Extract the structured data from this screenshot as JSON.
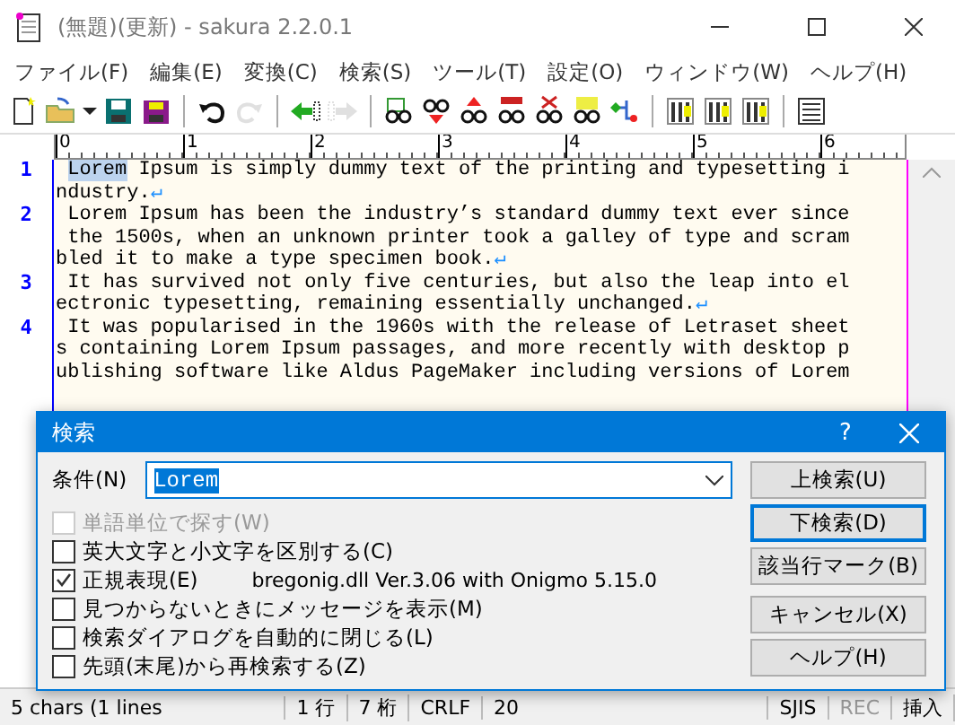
{
  "window": {
    "title": "(無題)(更新) - sakura 2.2.0.1"
  },
  "menu": [
    "ファイル(F)",
    "編集(E)",
    "変換(C)",
    "検索(S)",
    "ツール(T)",
    "設定(O)",
    "ウィンドウ(W)",
    "ヘルプ(H)"
  ],
  "toolbar": [
    {
      "kind": "new",
      "disabled": false
    },
    {
      "kind": "open",
      "disabled": false
    },
    {
      "kind": "caret",
      "disabled": false
    },
    {
      "kind": "save",
      "disabled": false
    },
    {
      "kind": "saveas",
      "disabled": false
    },
    {
      "kind": "separator"
    },
    {
      "kind": "undo",
      "disabled": false
    },
    {
      "kind": "redo",
      "disabled": true
    },
    {
      "kind": "separator"
    },
    {
      "kind": "back",
      "disabled": false
    },
    {
      "kind": "forward",
      "disabled": true
    },
    {
      "kind": "separator"
    },
    {
      "kind": "find",
      "disabled": false
    },
    {
      "kind": "findnext",
      "disabled": false
    },
    {
      "kind": "findprev",
      "disabled": false
    },
    {
      "kind": "replace",
      "disabled": false
    },
    {
      "kind": "clear",
      "disabled": false
    },
    {
      "kind": "grep",
      "disabled": false
    },
    {
      "kind": "outline",
      "disabled": false
    },
    {
      "kind": "separator"
    },
    {
      "kind": "settings",
      "disabled": false
    },
    {
      "kind": "settings",
      "disabled": false
    },
    {
      "kind": "settings",
      "disabled": false
    },
    {
      "kind": "separator"
    },
    {
      "kind": "list",
      "disabled": false
    }
  ],
  "ruler": {
    "labels": [
      "0",
      "1",
      "2",
      "3",
      "4",
      "5",
      "6"
    ]
  },
  "editor": {
    "paragraphs": [
      {
        "number": "1",
        "eol": "↵",
        "indent": true,
        "lines": [
          [
            {
              "text": "Lorem",
              "selected": true
            },
            {
              "text": " Ipsum is simply dummy text of the printing and typesetting i",
              "selected": false
            }
          ],
          [
            {
              "text": "ndustry.",
              "selected": false
            }
          ]
        ]
      },
      {
        "number": "2",
        "eol": "↵",
        "lines": [
          [
            {
              "text": " Lorem Ipsum has been the industry’s standard dummy text ever since",
              "selected": false
            }
          ],
          [
            {
              "text": " the 1500s, when an unknown printer took a galley of type and scram",
              "selected": false
            }
          ],
          [
            {
              "text": "bled it to make a type specimen book.",
              "selected": false
            }
          ]
        ]
      },
      {
        "number": "3",
        "eol": "↵",
        "lines": [
          [
            {
              "text": " It has survived not only five centuries, but also the leap into el",
              "selected": false
            }
          ],
          [
            {
              "text": "ectronic typesetting, remaining essentially unchanged.",
              "selected": false
            }
          ]
        ]
      },
      {
        "number": "4",
        "lines": [
          [
            {
              "text": " It was popularised in the 1960s with the release of Letraset sheet",
              "selected": false
            }
          ],
          [
            {
              "text": "s containing Lorem Ipsum passages, and more recently with desktop p",
              "selected": false
            }
          ],
          [
            {
              "text": "ublishing software like Aldus PageMaker including versions of Lorem",
              "selected": false
            }
          ]
        ]
      }
    ]
  },
  "dialog": {
    "title": "検索",
    "help": "?",
    "condition": {
      "label": "条件(N)",
      "value": "Lorem",
      "value_selected": true
    },
    "options": [
      {
        "label": "単語単位で探す(W)",
        "checked": false,
        "disabled": true
      },
      {
        "label": "英大文字と小文字を区別する(C)",
        "checked": false,
        "disabled": false
      },
      {
        "label": "正規表現(E)",
        "checked": true,
        "disabled": false,
        "note": "bregonig.dll Ver.3.06 with Onigmo 5.15.0"
      },
      {
        "label": "見つからないときにメッセージを表示(M)",
        "checked": false,
        "disabled": false
      },
      {
        "label": "検索ダイアログを自動的に閉じる(L)",
        "checked": false,
        "disabled": false
      },
      {
        "label": "先頭(末尾)から再検索する(Z)",
        "checked": false,
        "disabled": false
      }
    ],
    "buttons": [
      {
        "label": "上検索(U)",
        "default": false
      },
      {
        "label": "下検索(D)",
        "default": true
      },
      {
        "label": "該当行マーク(B)",
        "default": false
      },
      {
        "label": "キャンセル(X)",
        "default": false
      },
      {
        "label": "ヘルプ(H)",
        "default": false
      }
    ]
  },
  "status_bar": [
    {
      "text": "5 chars (1 lines",
      "disabled": false
    },
    {
      "text": "1 行",
      "disabled": false
    },
    {
      "text": "7 桁",
      "disabled": false
    },
    {
      "text": "CRLF",
      "disabled": false
    },
    {
      "text": "20",
      "disabled": false
    },
    {
      "text": "SJIS",
      "disabled": false
    },
    {
      "text": "REC",
      "disabled": true
    },
    {
      "text": "挿入",
      "disabled": false
    }
  ]
}
